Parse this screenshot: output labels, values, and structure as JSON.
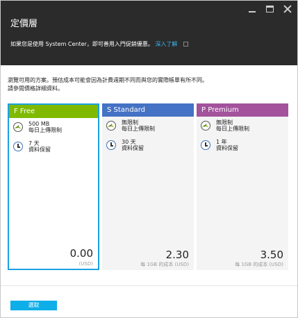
{
  "window": {
    "title": "定價層"
  },
  "promo": {
    "text": "如果您是使用 System Center，即可善用入門促銷優惠。",
    "link": "深入了解"
  },
  "description": {
    "line1": "瀏覽可用的方案。預估成本可能會因為計費週期不同而與您的實際帳單有所不同。",
    "line2": "請參閱價格詳細資料。"
  },
  "tiers": [
    {
      "name": "F Free",
      "color": "#7fba00",
      "selected": true,
      "features": [
        {
          "icon": "gauge-icon",
          "value": "500 MB",
          "label": "每日上傳限制"
        },
        {
          "icon": "clock-icon",
          "value": "7 天",
          "label": "資料保留"
        }
      ],
      "price": "0.00",
      "price_note": "(USD)"
    },
    {
      "name": "S Standard",
      "color": "#4472c4",
      "selected": false,
      "features": [
        {
          "icon": "gauge-icon",
          "value": "無限制",
          "label": "每日上傳限制"
        },
        {
          "icon": "clock-icon",
          "value": "30 天",
          "label": "資料保留"
        }
      ],
      "price": "2.30",
      "price_note": "每 1GB 的成本 (USD)"
    },
    {
      "name": "P Premium",
      "color": "#a3529c",
      "selected": false,
      "features": [
        {
          "icon": "gauge-icon",
          "value": "無限制",
          "label": "每日上傳限制"
        },
        {
          "icon": "clock-icon",
          "value": "1 年",
          "label": "資料保留"
        }
      ],
      "price": "3.50",
      "price_note": "每 1GB 的成本 (USD)"
    }
  ],
  "footer": {
    "select_label": "選取"
  }
}
